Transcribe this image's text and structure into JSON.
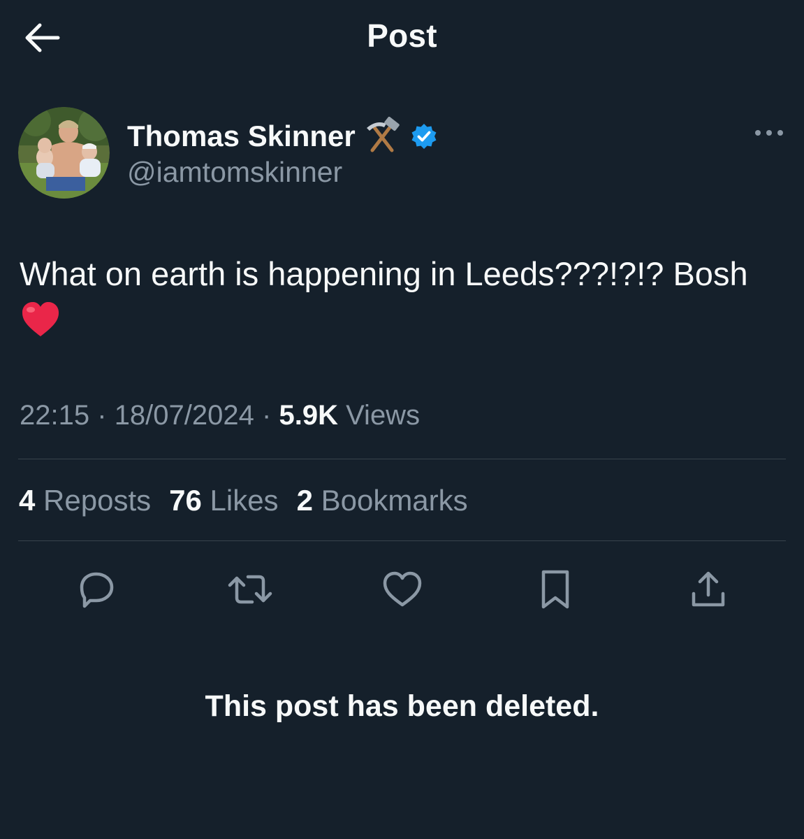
{
  "header": {
    "title": "Post",
    "back_icon": "arrow-left-icon"
  },
  "author": {
    "name": "Thomas Skinner",
    "name_emoji": "⚒️",
    "handle": "@iamtomskinner",
    "verified": true,
    "verified_color": "#1d9bf0"
  },
  "post": {
    "text": "What on earth is happening in Leeds???!?!? Bosh",
    "emoji": "❤️"
  },
  "meta": {
    "time": "22:15",
    "separator": "·",
    "date": "18/07/2024",
    "views_count": "5.9K",
    "views_label": "Views"
  },
  "stats": {
    "reposts_count": "4",
    "reposts_label": "Reposts",
    "likes_count": "76",
    "likes_label": "Likes",
    "bookmarks_count": "2",
    "bookmarks_label": "Bookmarks"
  },
  "actions": {
    "icons": [
      "reply-icon",
      "repost-icon",
      "like-icon",
      "bookmark-icon",
      "share-icon"
    ]
  },
  "notice": {
    "deleted": "This post has been deleted."
  },
  "colors": {
    "background": "#15202b",
    "text_primary": "#f7f9f9",
    "text_secondary": "#8b98a5",
    "divider": "#38444d",
    "heart": "#e0245e"
  }
}
